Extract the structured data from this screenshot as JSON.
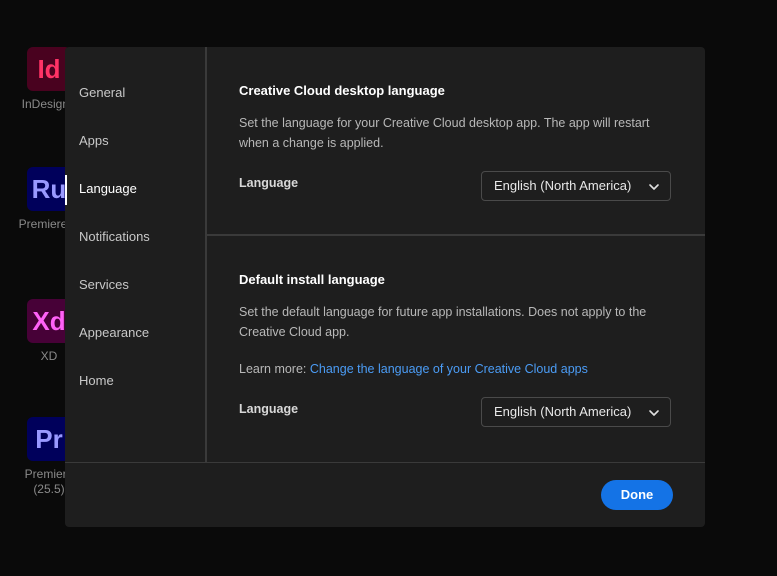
{
  "background_apps": [
    {
      "tile": "Id",
      "label": "InDesign (",
      "bg": "#49021f",
      "fg": "#ff3366"
    },
    {
      "tile": "Ru",
      "label": "Premiere R",
      "bg": "#00005b",
      "fg": "#9999ff"
    },
    {
      "tile": "Xd",
      "label": "XD",
      "bg": "#470137",
      "fg": "#ff61f6"
    },
    {
      "tile": "Pr",
      "label": "Premiere",
      "sublabel": "(25.5)",
      "bg": "#00005b",
      "fg": "#9999ff"
    }
  ],
  "sidebar": {
    "items": [
      {
        "label": "General"
      },
      {
        "label": "Apps"
      },
      {
        "label": "Language",
        "active": true
      },
      {
        "label": "Notifications"
      },
      {
        "label": "Services"
      },
      {
        "label": "Appearance"
      },
      {
        "label": "Home"
      }
    ]
  },
  "desktop_language": {
    "title": "Creative Cloud desktop language",
    "description": "Set the language for your Creative Cloud desktop app. The app will restart when a change is applied.",
    "field_label": "Language",
    "selected": "English (North America)"
  },
  "install_language": {
    "title": "Default install language",
    "description": "Set the default language for future app installations. Does not apply to the Creative Cloud app.",
    "learn_more_prefix": "Learn more: ",
    "learn_more_link": "Change the language of your Creative Cloud apps",
    "field_label": "Language",
    "selected": "English (North America)"
  },
  "footer": {
    "done_label": "Done"
  },
  "colors": {
    "accent": "#1473e6",
    "link": "#4b9cf5",
    "panel": "#1e1e1e"
  }
}
